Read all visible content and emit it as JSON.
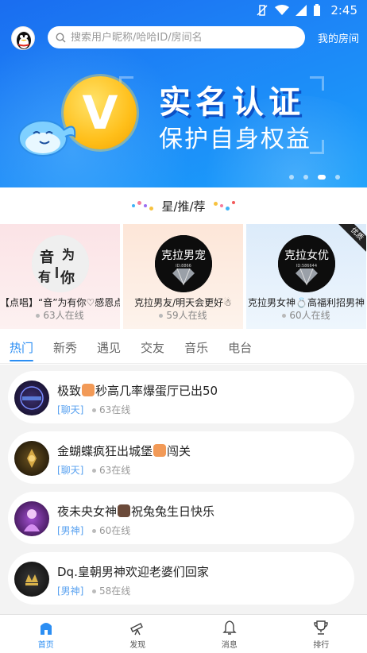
{
  "status_bar": {
    "time": "2:45"
  },
  "header": {
    "search_placeholder": "搜索用户昵称/哈哈ID/房间名",
    "my_room": "我的房间"
  },
  "banner": {
    "coin_letter": "V",
    "title": "实名认证",
    "subtitle": "保护自身权益",
    "page_count": 4,
    "active_page": 3
  },
  "recommend": {
    "title": "星/推/荐",
    "cards": [
      {
        "name": "【点唱】“音”为有你♡感恩点",
        "online": "63人在线",
        "avatar_text": "音为有你",
        "bg": "#fde8ea"
      },
      {
        "name": "克拉男友/明天会更好☃",
        "online": "59人在线",
        "avatar_text": "克拉男宠",
        "bg": "#fdebe0"
      },
      {
        "name": "克拉男女神💍高福利招男神",
        "online": "60人在线",
        "avatar_text": "克拉女优",
        "bg": "#e4f0fb",
        "badge": "优质"
      }
    ]
  },
  "tabs": [
    "热门",
    "新秀",
    "遇见",
    "交友",
    "音乐",
    "电台"
  ],
  "active_tab": 0,
  "rooms": [
    {
      "title_pre": "极致",
      "title_post": "秒高几率爆蛋厅已出50",
      "category": "[聊天]",
      "online": "63在线",
      "emoji_color": "#f29a57",
      "avatar_bg": "#1d1a3a"
    },
    {
      "title_pre": "金蝴蝶疯狂出城堡",
      "title_post": "闯关",
      "category": "[聊天]",
      "online": "63在线",
      "emoji_color": "#f29a57",
      "avatar_bg": "#2a2015"
    },
    {
      "title_pre": "夜未央女神",
      "title_post": "祝兔兔生日快乐",
      "category": "[男神]",
      "online": "60在线",
      "emoji_color": "#6b4a3a",
      "avatar_bg": "#3a1450"
    },
    {
      "title_pre": "Dq.皇朝男神欢迎老婆们回家",
      "title_post": "",
      "category": "[男神]",
      "online": "58在线",
      "emoji_color": "",
      "avatar_bg": "#161616"
    }
  ],
  "bottom_nav": [
    {
      "label": "首页",
      "icon": "home-icon"
    },
    {
      "label": "发现",
      "icon": "telescope-icon"
    },
    {
      "label": "消息",
      "icon": "bell-icon"
    },
    {
      "label": "排行",
      "icon": "trophy-icon"
    }
  ],
  "colors": {
    "accent": "#2b8ef3",
    "banner_blue": "#1d86f7"
  }
}
